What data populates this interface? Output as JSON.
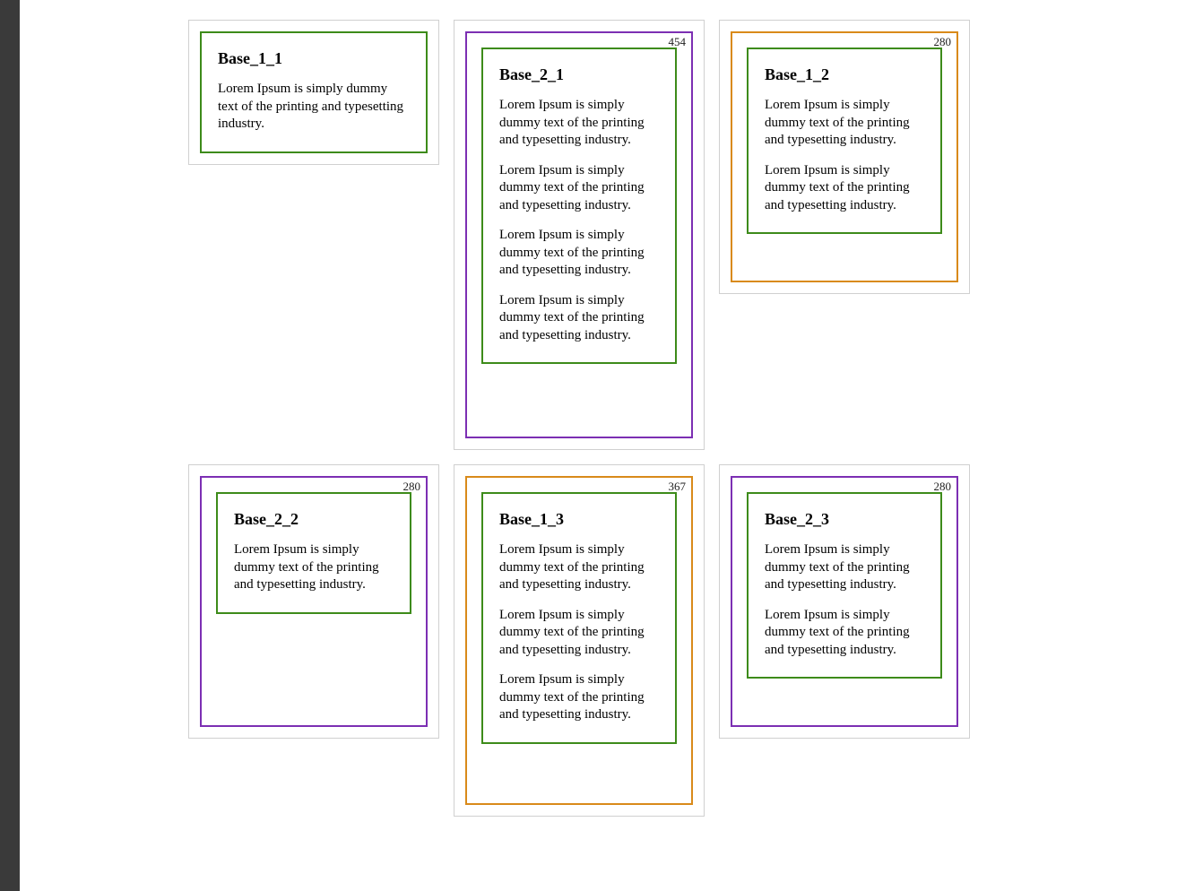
{
  "lorem": "Lorem Ipsum is simply dummy text of the printing and typesetting industry.",
  "cards": [
    {
      "id": "card-0",
      "title": "Base_1_1",
      "paragraph_count": 1,
      "outer_color": "none",
      "height_label": null,
      "outer_min_height": null
    },
    {
      "id": "card-1",
      "title": "Base_2_1",
      "paragraph_count": 4,
      "outer_color": "purple",
      "height_label": "454",
      "outer_min_height": 454
    },
    {
      "id": "card-2",
      "title": "Base_1_2",
      "paragraph_count": 2,
      "outer_color": "orange",
      "height_label": "280",
      "outer_min_height": 280
    },
    {
      "id": "card-3",
      "title": "Base_2_2",
      "paragraph_count": 1,
      "outer_color": "purple",
      "height_label": "280",
      "outer_min_height": 280
    },
    {
      "id": "card-4",
      "title": "Base_1_3",
      "paragraph_count": 3,
      "outer_color": "orange",
      "height_label": "367",
      "outer_min_height": 367
    },
    {
      "id": "card-5",
      "title": "Base_2_3",
      "paragraph_count": 2,
      "outer_color": "purple",
      "height_label": "280",
      "outer_min_height": 280
    }
  ]
}
